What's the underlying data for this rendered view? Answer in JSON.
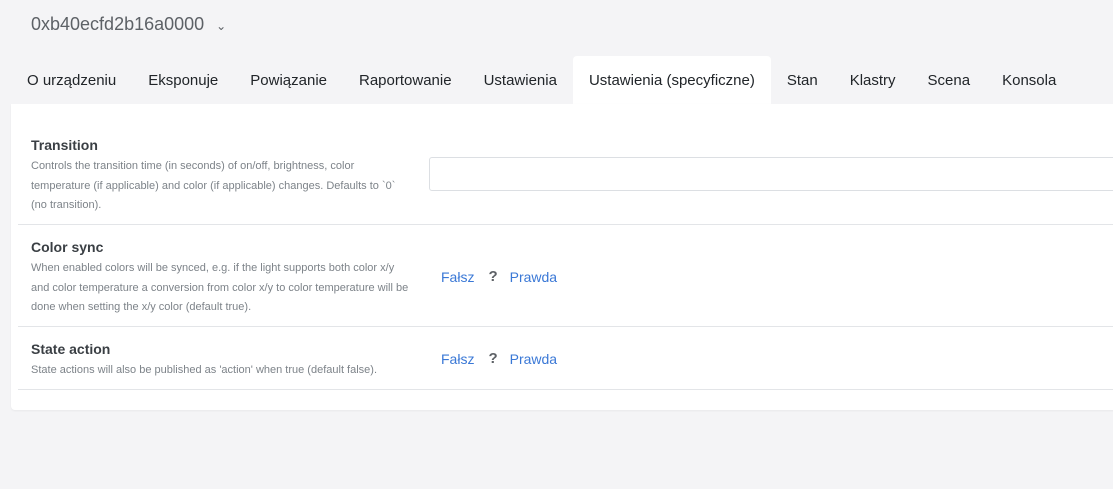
{
  "device": {
    "name": "0xb40ecfd2b16a0000"
  },
  "tabs": [
    {
      "label": "O urządzeniu"
    },
    {
      "label": "Eksponuje"
    },
    {
      "label": "Powiązanie"
    },
    {
      "label": "Raportowanie"
    },
    {
      "label": "Ustawienia"
    },
    {
      "label": "Ustawienia (specyficzne)"
    },
    {
      "label": "Stan"
    },
    {
      "label": "Klastry"
    },
    {
      "label": "Scena"
    },
    {
      "label": "Konsola"
    }
  ],
  "active_tab": "Ustawienia (specyficzne)",
  "settings": {
    "transition": {
      "label": "Transition",
      "description": "Controls the transition time (in seconds) of on/off, brightness, color temperature (if applicable) and color (if applicable) changes. Defaults to `0` (no transition).",
      "value": ""
    },
    "color_sync": {
      "label": "Color sync",
      "description": "When enabled colors will be synced, e.g. if the light supports both color x/y and color temperature a conversion from color x/y to color temperature will be done when setting the x/y color (default true).",
      "false_label": "Fałsz",
      "unknown_label": "?",
      "true_label": "Prawda"
    },
    "state_action": {
      "label": "State action",
      "description": "State actions will also be published as 'action' when true (default false).",
      "false_label": "Fałsz",
      "unknown_label": "?",
      "true_label": "Prawda"
    }
  }
}
